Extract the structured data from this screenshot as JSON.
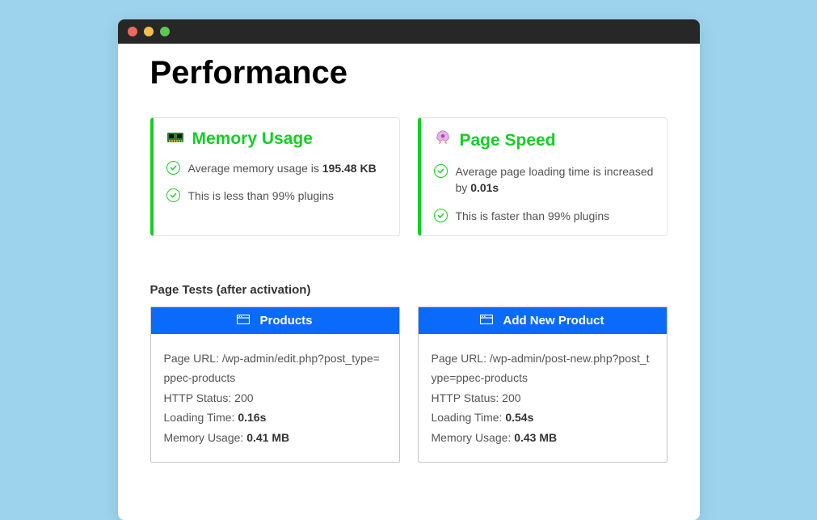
{
  "pageTitle": "Performance",
  "summary": {
    "memory": {
      "icon": "🟢",
      "title": "Memory Usage",
      "line1_pre": "Average memory usage is ",
      "line1_bold": "195.48 KB",
      "line2": "This is less than 99% plugins"
    },
    "speed": {
      "icon": "🚀",
      "title": "Page Speed",
      "line1_pre": "Average page loading time is increased by ",
      "line1_bold": "0.01s",
      "line2": "This is faster than 99% plugins"
    }
  },
  "sectionHeader": "Page Tests (after activation)",
  "tests": {
    "products": {
      "title": "Products",
      "urlLabel": "Page URL: ",
      "url": "/wp-admin/edit.php?post_type=ppec-products",
      "statusLabel": "HTTP Status: ",
      "status": "200",
      "loadLabel": "Loading Time: ",
      "loadValue": "0.16s",
      "memLabel": "Memory Usage: ",
      "memValue": "0.41 MB"
    },
    "addProduct": {
      "title": "Add New Product",
      "urlLabel": "Page URL: ",
      "url": "/wp-admin/post-new.php?post_type=ppec-products",
      "statusLabel": "HTTP Status: ",
      "status": "200",
      "loadLabel": "Loading Time: ",
      "loadValue": "0.54s",
      "memLabel": "Memory Usage: ",
      "memValue": "0.43 MB"
    }
  }
}
